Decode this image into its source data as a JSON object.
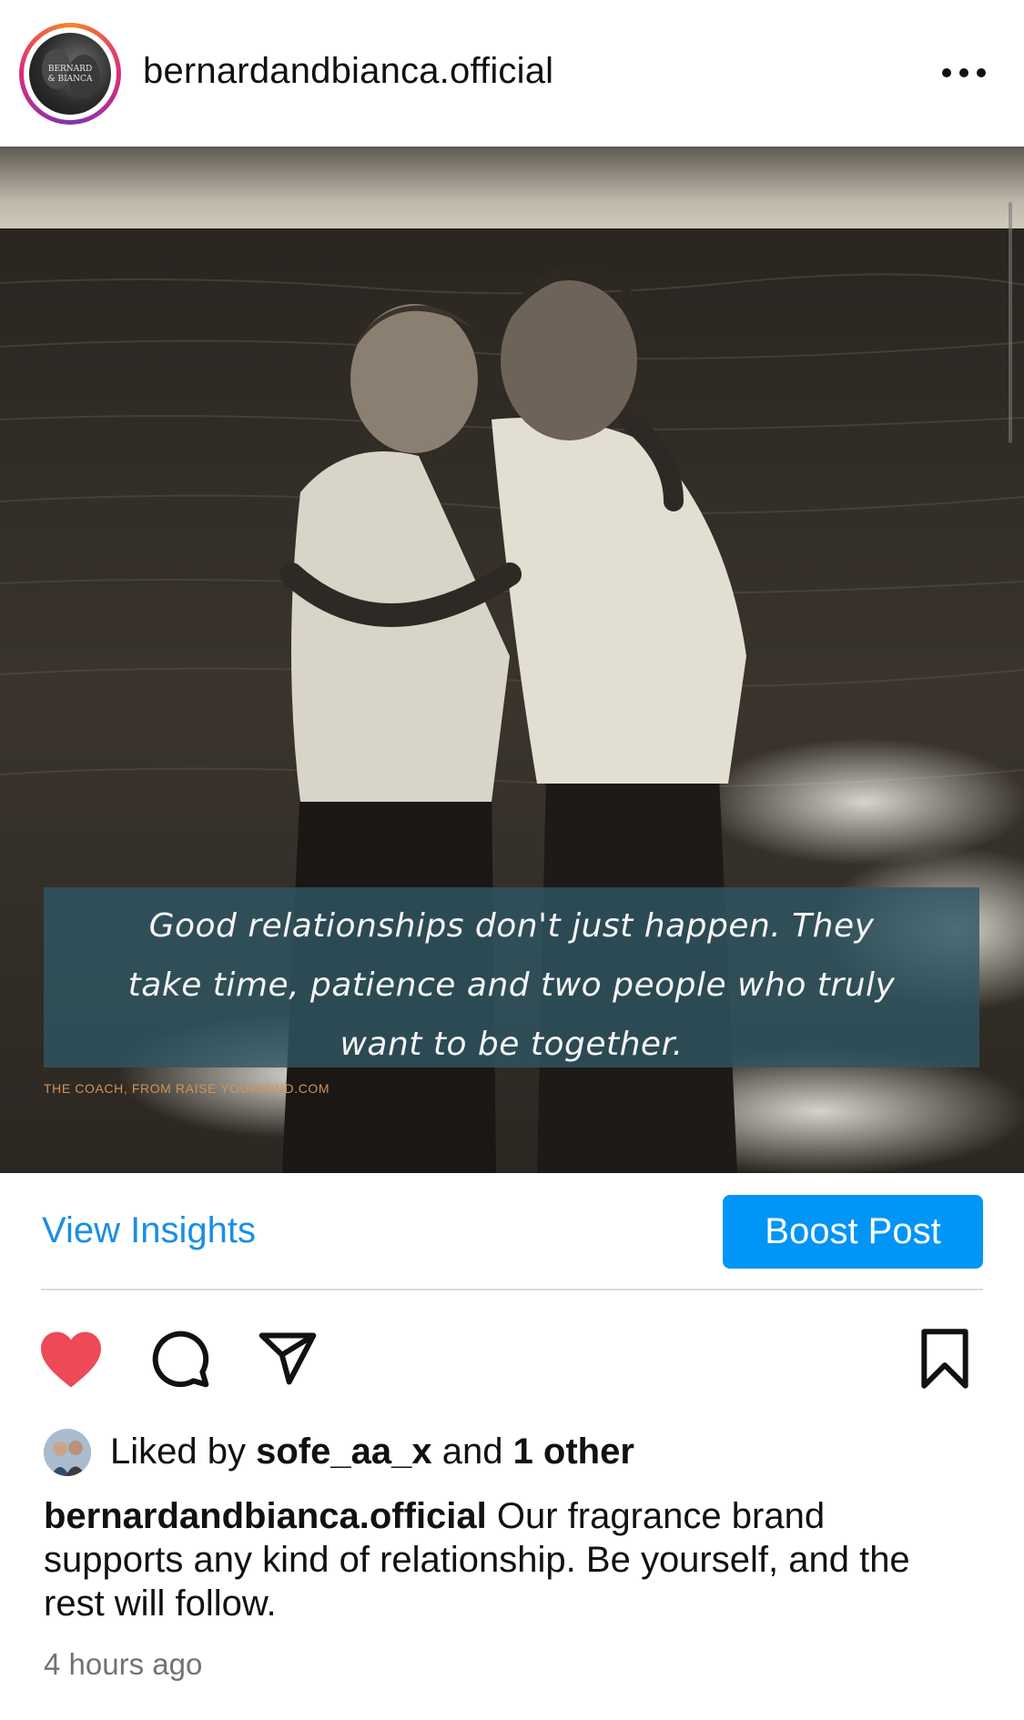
{
  "header": {
    "username": "bernardandbianca.official",
    "avatar_logo_text": "BERNARD & BIANCA",
    "more_icon": "more-horizontal-icon"
  },
  "post": {
    "quote": "Good relationships don't just happen. They take time, patience and two people who truly want to be together.",
    "quote_lines": [
      "Good relationships don't just happen. They",
      "take time, patience and two people who truly",
      "want to be together."
    ],
    "credit": "THE COACH, FROM RAISE YOURMIND.COM"
  },
  "actions": {
    "view_insights": "View Insights",
    "boost_post": "Boost Post",
    "like_icon": "heart-filled-icon",
    "comment_icon": "comment-icon",
    "share_icon": "share-icon",
    "save_icon": "bookmark-icon"
  },
  "likes": {
    "prefix": "Liked by ",
    "user": "sofe_aa_x",
    "middle": " and ",
    "others": "1 other"
  },
  "caption": {
    "username": "bernardandbianca.official",
    "text": " Our fragrance brand supports any kind of relationship. Be yourself, and the rest will follow."
  },
  "timestamp": "4 hours ago",
  "colors": {
    "accent_blue": "#0095f6",
    "link_blue": "#1a8fe3",
    "heart_red": "#ed4956",
    "quote_box": "#2f5662",
    "credit": "#d1935a"
  }
}
